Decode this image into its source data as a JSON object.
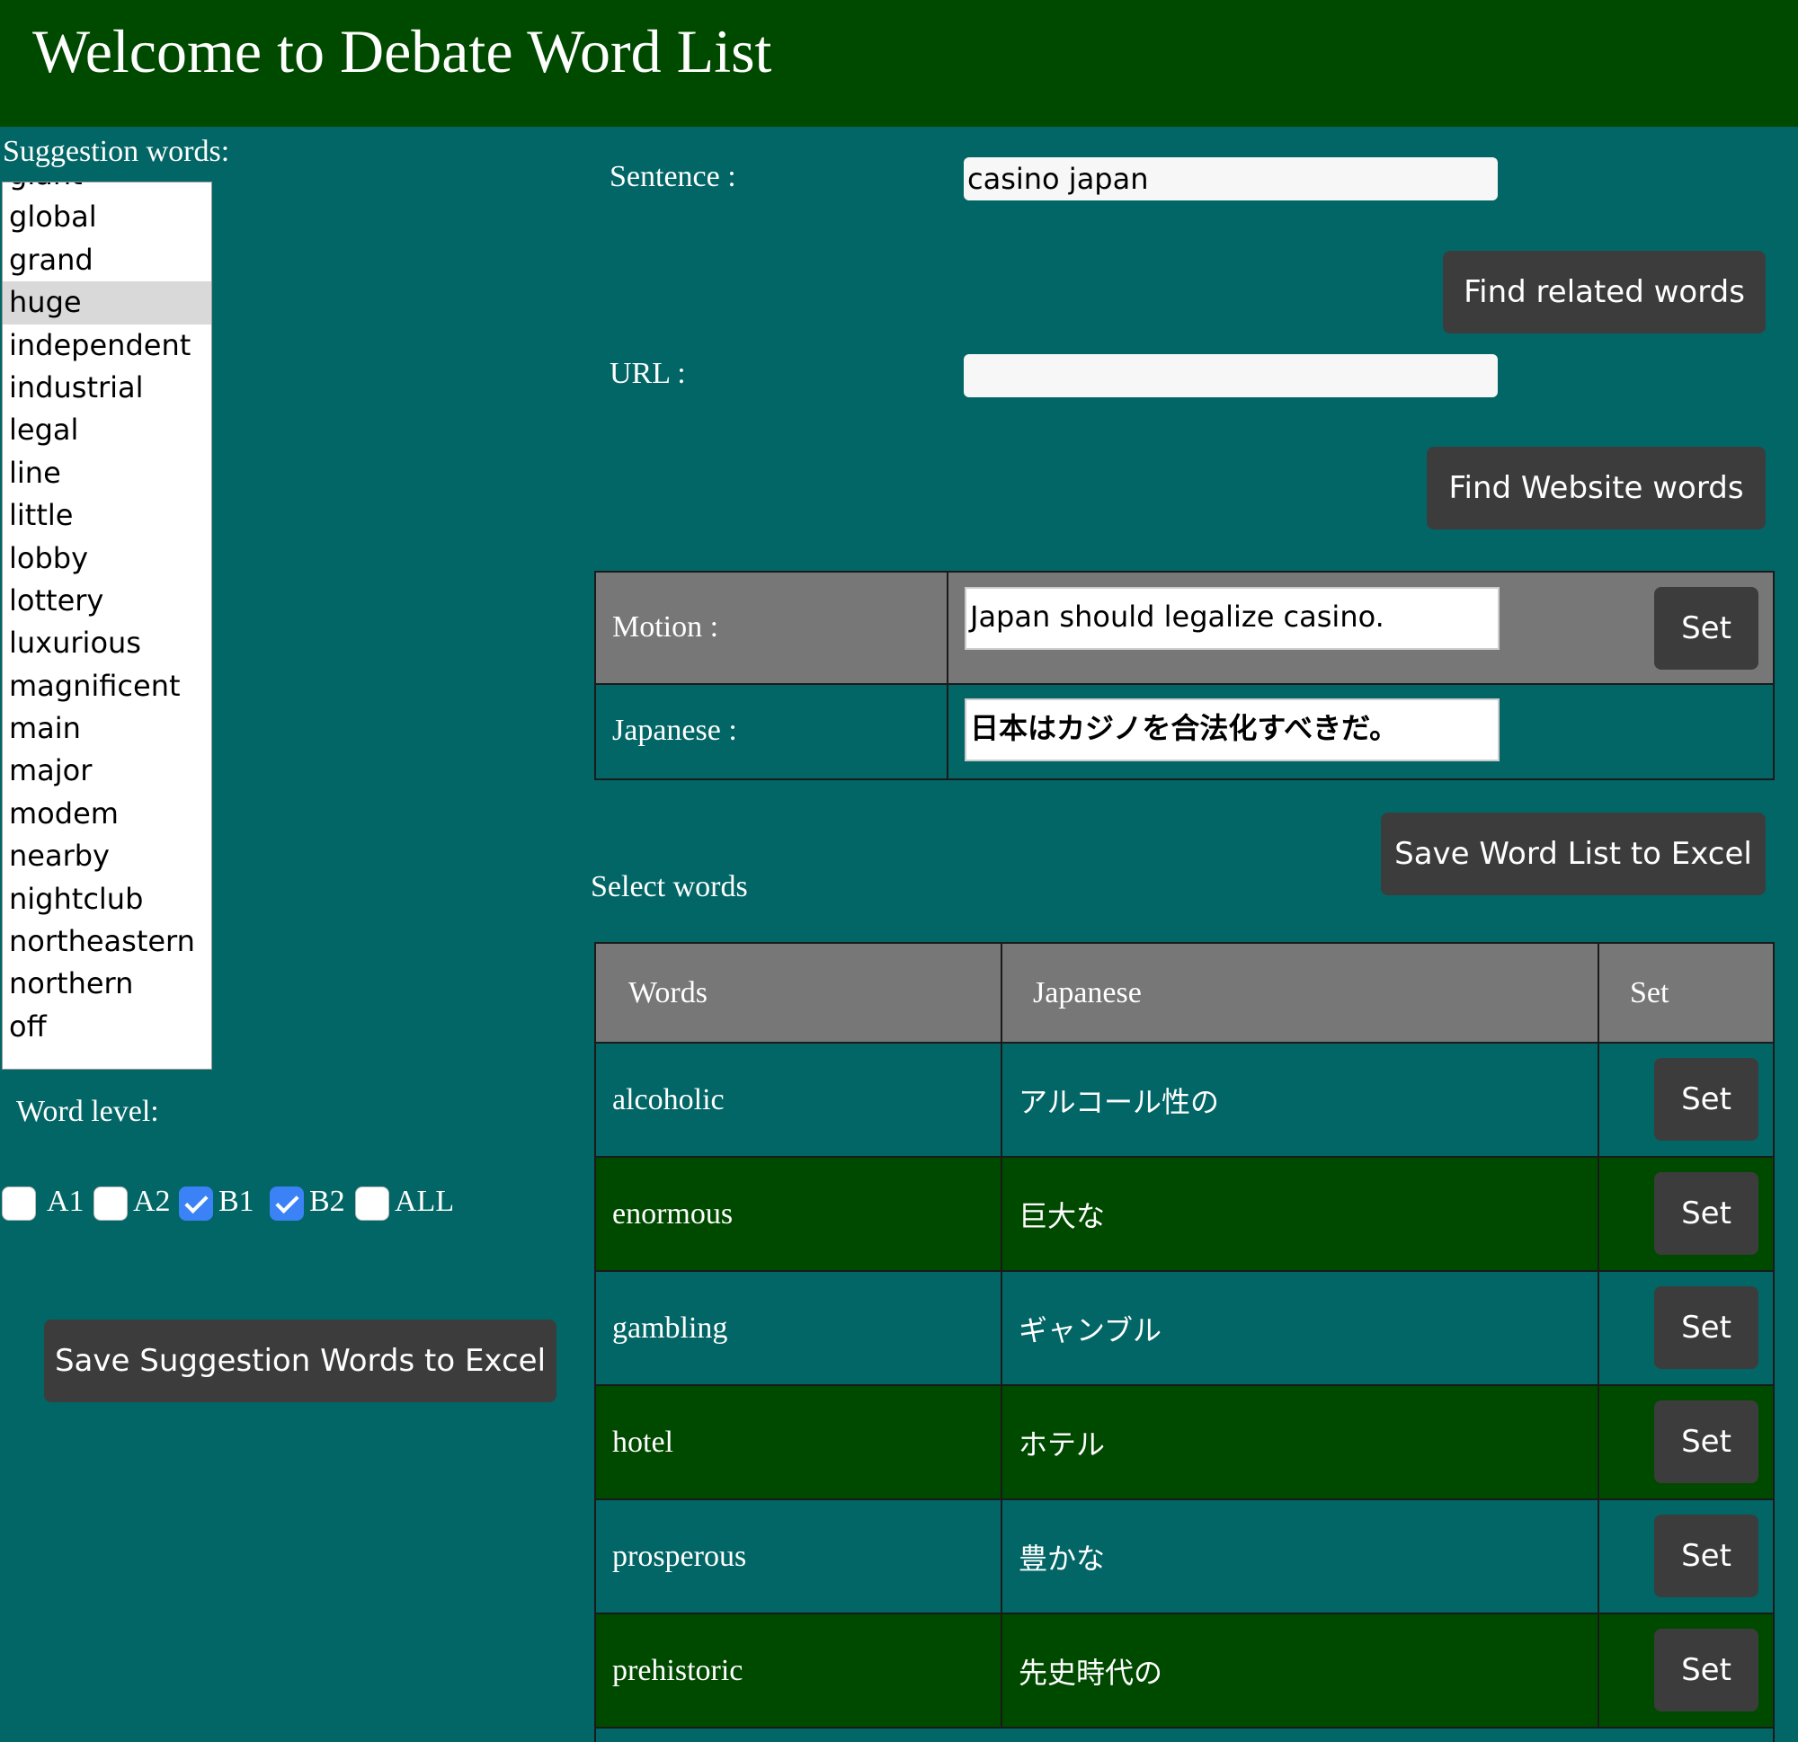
{
  "header": {
    "title": "Welcome to Debate Word List"
  },
  "suggestions": {
    "label": "Suggestion words:",
    "items": [
      "giant",
      "global",
      "grand",
      "huge",
      "independent",
      "industrial",
      "legal",
      "line",
      "little",
      "lobby",
      "lottery",
      "luxurious",
      "magnificent",
      "main",
      "major",
      "modem",
      "nearby",
      "nightclub",
      "northeastern",
      "northern",
      "off"
    ],
    "selected": "huge"
  },
  "word_level": {
    "label": "Word level:",
    "levels": [
      {
        "name": "A1",
        "checked": false
      },
      {
        "name": "A2",
        "checked": false
      },
      {
        "name": "B1",
        "checked": true
      },
      {
        "name": "B2",
        "checked": true
      },
      {
        "name": "ALL",
        "checked": false
      }
    ]
  },
  "save_suggestions_label": "Save Suggestion Words to Excel",
  "sentence": {
    "label": "Sentence :",
    "value": "casino japan"
  },
  "find_related_label": "Find related words",
  "url": {
    "label": "URL :",
    "value": ""
  },
  "find_website_label": "Find Website words",
  "motion": {
    "label": "Motion :",
    "value": "Japan should legalize casino.",
    "set_label": "Set"
  },
  "japanese": {
    "label": "Japanese :",
    "value": "日本はカジノを合法化すべきだ。"
  },
  "save_wordlist_label": "Save Word List to Excel",
  "select_words_label": "Select words",
  "table": {
    "headers": {
      "words": "Words",
      "japanese": "Japanese",
      "set": "Set"
    },
    "set_label": "Set",
    "rows": [
      {
        "word": "alcoholic",
        "japanese": "アルコール性の"
      },
      {
        "word": "enormous",
        "japanese": "巨大な"
      },
      {
        "word": "gambling",
        "japanese": "ギャンブル"
      },
      {
        "word": "hotel",
        "japanese": "ホテル"
      },
      {
        "word": "prosperous",
        "japanese": "豊かな"
      },
      {
        "word": "prehistoric",
        "japanese": "先史時代の"
      }
    ]
  },
  "colors": {
    "header_bg": "#004a00",
    "page_bg": "#026666",
    "button_bg": "#3c3c3c",
    "table_head_bg": "#777777",
    "row_alt_bg": "#004a00"
  }
}
